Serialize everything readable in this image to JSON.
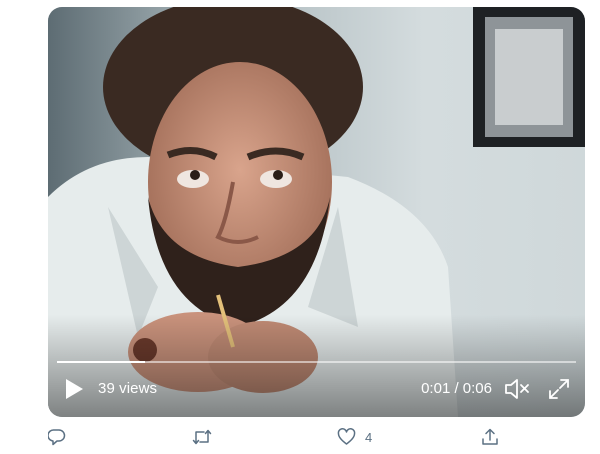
{
  "player": {
    "views": "39 views",
    "time": "0:01 / 0:06",
    "progress": 0.17
  },
  "actions": {
    "reply_icon": "reply-icon",
    "retweet_icon": "retweet-icon",
    "like_icon": "heart-icon",
    "like_count": "4",
    "share_icon": "share-icon"
  },
  "colors": {
    "icon_gray": "#5b7083",
    "overlay_text": "#ffffff"
  }
}
